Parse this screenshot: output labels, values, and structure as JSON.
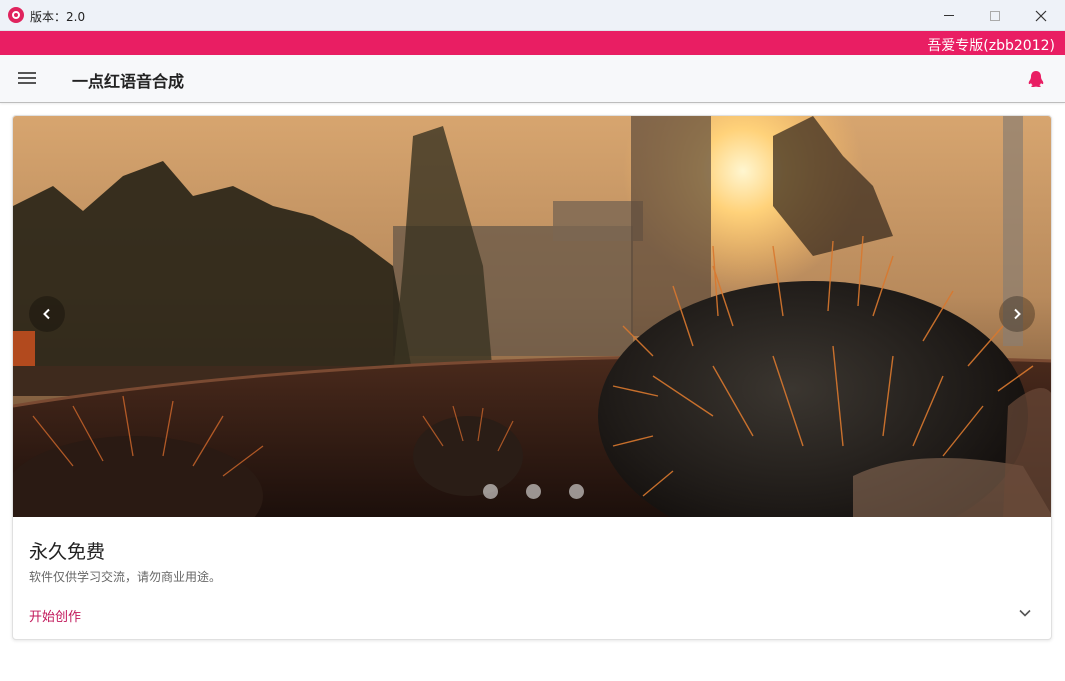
{
  "window": {
    "title": "版本：2.0",
    "icons": {
      "app": "app-logo-icon",
      "minimize": "minimize-icon",
      "maximize": "maximize-icon",
      "close": "close-icon"
    }
  },
  "banner": {
    "text": "吾爱专版(zbb2012)",
    "color": "#e91e63"
  },
  "toolbar": {
    "app_name": "一点红语音合成",
    "menu_icon": "menu-icon",
    "qq_icon": "qq-penguin-icon"
  },
  "carousel": {
    "image": "cactus-sunset-photo",
    "prev_icon": "chevron-left-icon",
    "next_icon": "chevron-right-icon",
    "slide_count": 3
  },
  "card": {
    "title": "永久免费",
    "subtitle": "软件仅供学习交流，请勿商业用途。",
    "action_label": "开始创作",
    "expand_icon": "chevron-down-icon"
  },
  "colors": {
    "accent": "#e91e63",
    "action_text": "#c2185b"
  }
}
